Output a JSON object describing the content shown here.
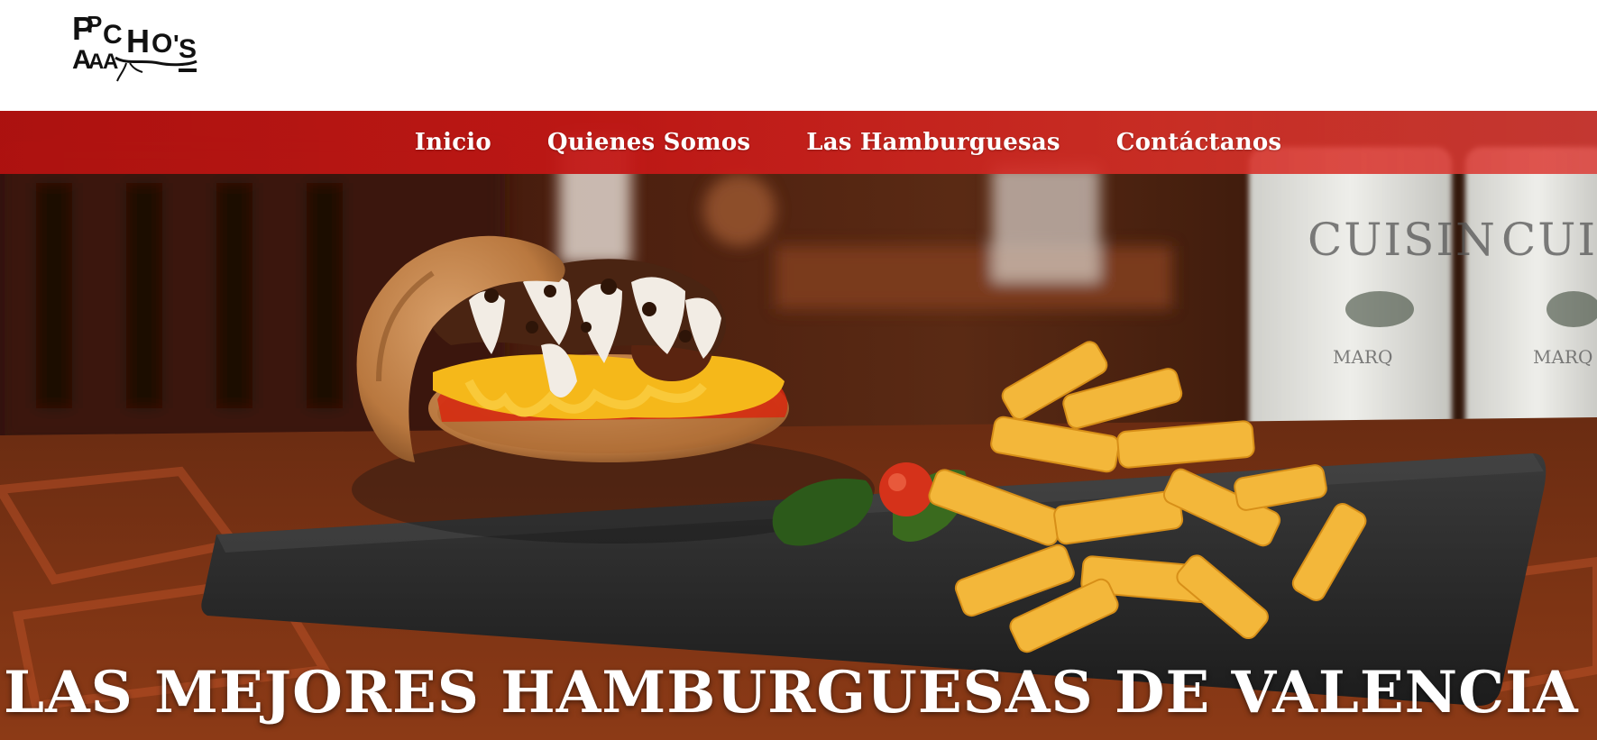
{
  "brand": {
    "name": "PAPACHO'S",
    "logo_lettering": "PAPACHO'S"
  },
  "nav": {
    "items": [
      {
        "label": "Inicio"
      },
      {
        "label": "Quienes Somos"
      },
      {
        "label": "Las Hamburguesas"
      },
      {
        "label": "Contáctanos"
      }
    ]
  },
  "hero": {
    "headline": "LAS MEJORES HAMBURGUESAS DE VALENCIA",
    "bottle_label": "CUISIN",
    "bottle_sublabel": "MARQ"
  },
  "colors": {
    "nav_bar": "#c41816",
    "headline": "#ffffff",
    "cheese": "#f5b81a",
    "slate": "#2b2b2b"
  }
}
